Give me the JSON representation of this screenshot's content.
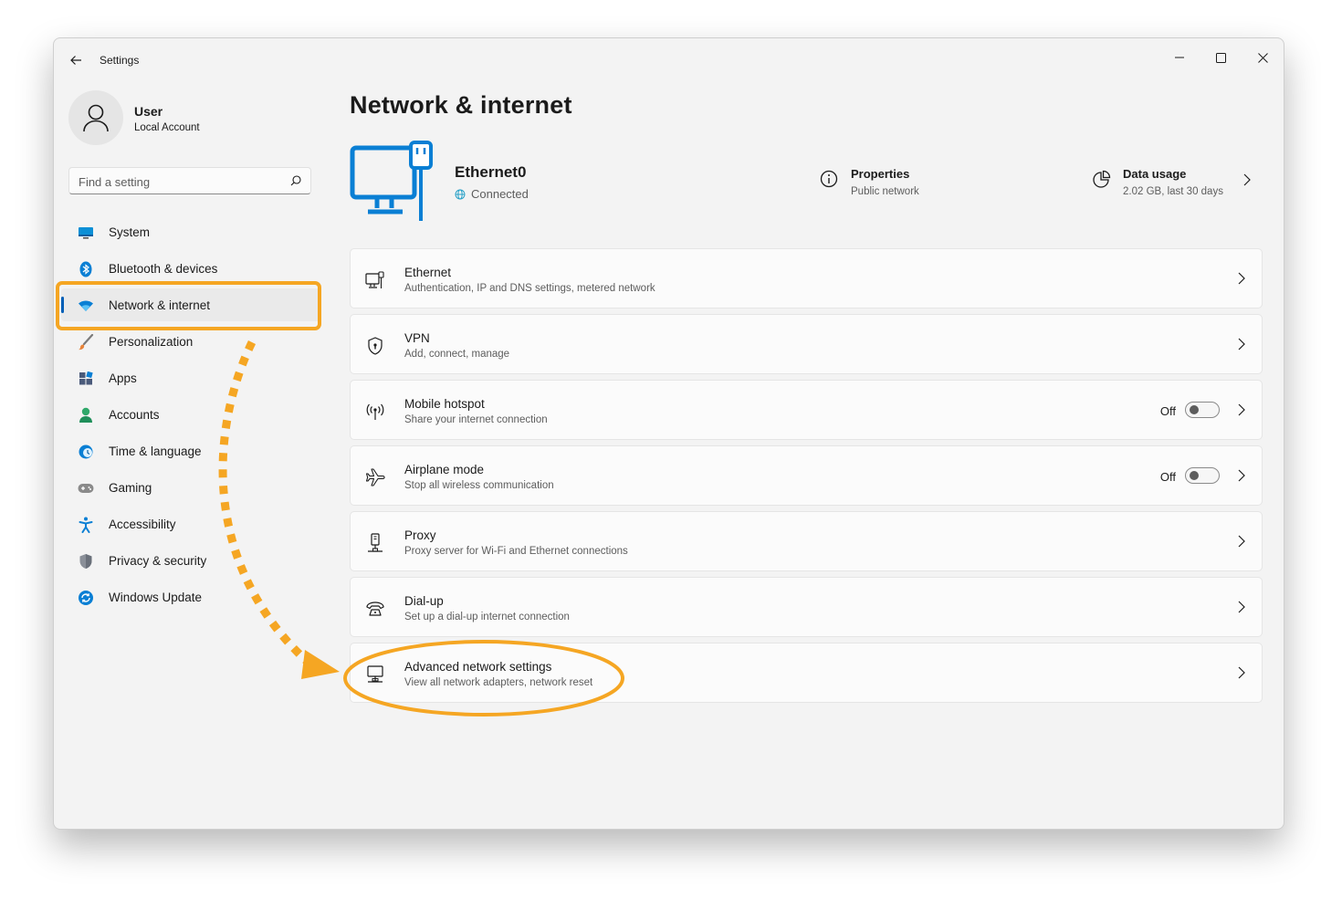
{
  "window": {
    "title": "Settings"
  },
  "user": {
    "name": "User",
    "account_type": "Local Account"
  },
  "search": {
    "placeholder": "Find a setting"
  },
  "sidebar": {
    "items": [
      {
        "label": "System"
      },
      {
        "label": "Bluetooth & devices"
      },
      {
        "label": "Network & internet"
      },
      {
        "label": "Personalization"
      },
      {
        "label": "Apps"
      },
      {
        "label": "Accounts"
      },
      {
        "label": "Time & language"
      },
      {
        "label": "Gaming"
      },
      {
        "label": "Accessibility"
      },
      {
        "label": "Privacy & security"
      },
      {
        "label": "Windows Update"
      }
    ],
    "active_index": 2
  },
  "page": {
    "title": "Network & internet",
    "connection": {
      "name": "Ethernet0",
      "status": "Connected"
    },
    "properties": {
      "title": "Properties",
      "subtitle": "Public network"
    },
    "data_usage": {
      "title": "Data usage",
      "subtitle": "2.02 GB, last 30 days"
    }
  },
  "cards": [
    {
      "title": "Ethernet",
      "subtitle": "Authentication, IP and DNS settings, metered network"
    },
    {
      "title": "VPN",
      "subtitle": "Add, connect, manage"
    },
    {
      "title": "Mobile hotspot",
      "subtitle": "Share your internet connection",
      "toggle_label": "Off"
    },
    {
      "title": "Airplane mode",
      "subtitle": "Stop all wireless communication",
      "toggle_label": "Off"
    },
    {
      "title": "Proxy",
      "subtitle": "Proxy server for Wi-Fi and Ethernet connections"
    },
    {
      "title": "Dial-up",
      "subtitle": "Set up a dial-up internet connection"
    },
    {
      "title": "Advanced network settings",
      "subtitle": "View all network adapters, network reset"
    }
  ],
  "colors": {
    "accent": "#005fb8",
    "highlight": "#f5a623",
    "window_bg": "#f3f3f3",
    "card_bg": "#fbfbfb"
  }
}
